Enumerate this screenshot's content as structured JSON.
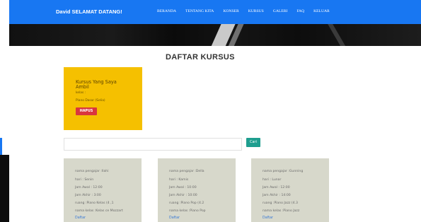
{
  "navbar": {
    "brand": "David SELAMAT DATANG!",
    "menu": [
      "BERANDA",
      "TENTANG KITA",
      "KONSER",
      "KURSUS",
      "GALERI",
      "FAQ",
      "KELUAR"
    ]
  },
  "page_title": "DAFTAR KURSUS",
  "taken": {
    "heading": "Kursus Yang Saya Ambil",
    "status": "kelas :",
    "course": "Piano Dasar (Selia)",
    "remove_label": "HAPUS"
  },
  "search": {
    "value": "",
    "button_label": "Cari"
  },
  "courses": [
    {
      "teacher": "nama pengajar :Ilahi",
      "day": "hari : Senin",
      "start": "Jam Awal : 12:00",
      "end": "Jam Akhir : 3:00",
      "room": "ruang :Piano Kelas (4 ,1",
      "class": "nama kelas :Kelas ce Mozzart",
      "action": "Daftar"
    },
    {
      "teacher": "nama pengajar :Della",
      "day": "hari : Kamis",
      "start": "Jam Awal : 10:00",
      "end": "Jam Akhir : 10:00",
      "room": "ruang :Piano Pop (4.2",
      "class": "nama kelas :Piano Pop",
      "action": "Daftar"
    },
    {
      "teacher": "nama pengajar :Gunning",
      "day": "hari : Lunar",
      "start": "Jam Awal : 12:00",
      "end": "Jam Akhir : 14:00",
      "room": "ruang :Piano Jazz (4.3",
      "class": "nama kelas :Piano Jazz",
      "action": "Daftar"
    }
  ],
  "colors": {
    "nav": "#1877f2",
    "card_taken": "#f5c000",
    "card": "#d7d8cb",
    "danger": "#d9363e",
    "search_btn": "#1f9e8f"
  }
}
